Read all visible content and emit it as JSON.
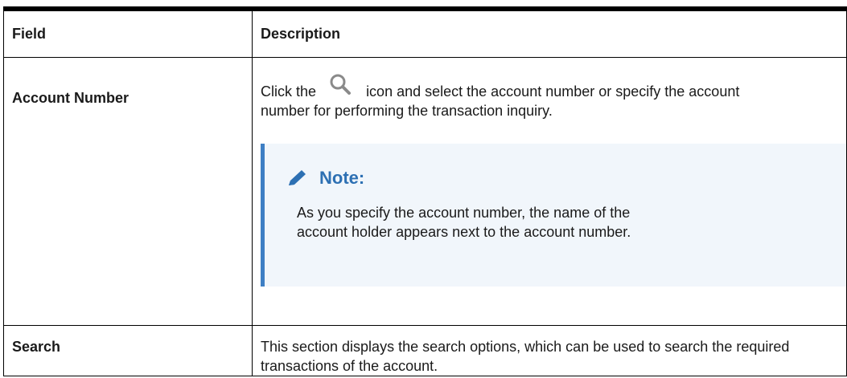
{
  "table": {
    "headers": {
      "field": "Field",
      "description": "Description"
    },
    "rows": [
      {
        "field": "Account Number",
        "desc_before_icon": "Click the",
        "desc_after_icon": "icon and select the account number or specify the account number for performing the transaction inquiry.",
        "icon": "search-icon",
        "note": {
          "title": "Note:",
          "icon": "pencil-icon",
          "text": "As you specify the account number, the name of the account holder appears next to the account number."
        }
      },
      {
        "field": "Search",
        "description": "This section displays the search options, which can be used to search the required transactions of the account."
      }
    ]
  },
  "colors": {
    "note_accent": "#3e7fc4",
    "note_bg": "#f1f6fb",
    "note_title": "#2d70b3"
  }
}
